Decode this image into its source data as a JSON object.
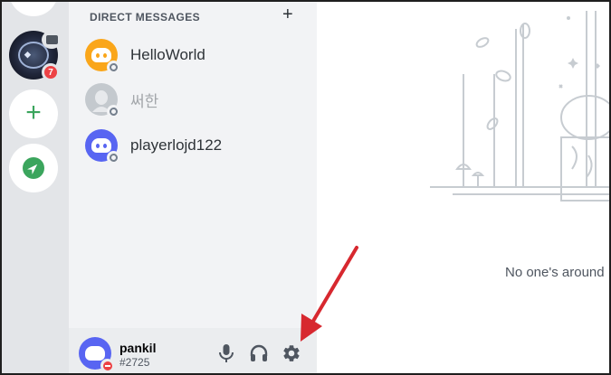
{
  "direct_messages": {
    "header": "DIRECT MESSAGES",
    "add_label": "+",
    "items": [
      {
        "name": "HelloWorld",
        "avatar_color": "#faa61a",
        "status": "offline"
      },
      {
        "name": "써한",
        "avatar_color": "#c4c9ce",
        "status": "offline"
      },
      {
        "name": "playerlojd122",
        "avatar_color": "#5865f2",
        "status": "offline"
      }
    ]
  },
  "servers": {
    "unread_badge": "7",
    "add_server_label": "+"
  },
  "user_panel": {
    "username": "pankil",
    "tag": "#2725",
    "status": "do-not-disturb"
  },
  "main": {
    "empty_state_text": "No one's around"
  },
  "colors": {
    "brand": "#5865f2",
    "green": "#3ba55d",
    "red": "#ed4245",
    "annotation": "#d7282f"
  }
}
